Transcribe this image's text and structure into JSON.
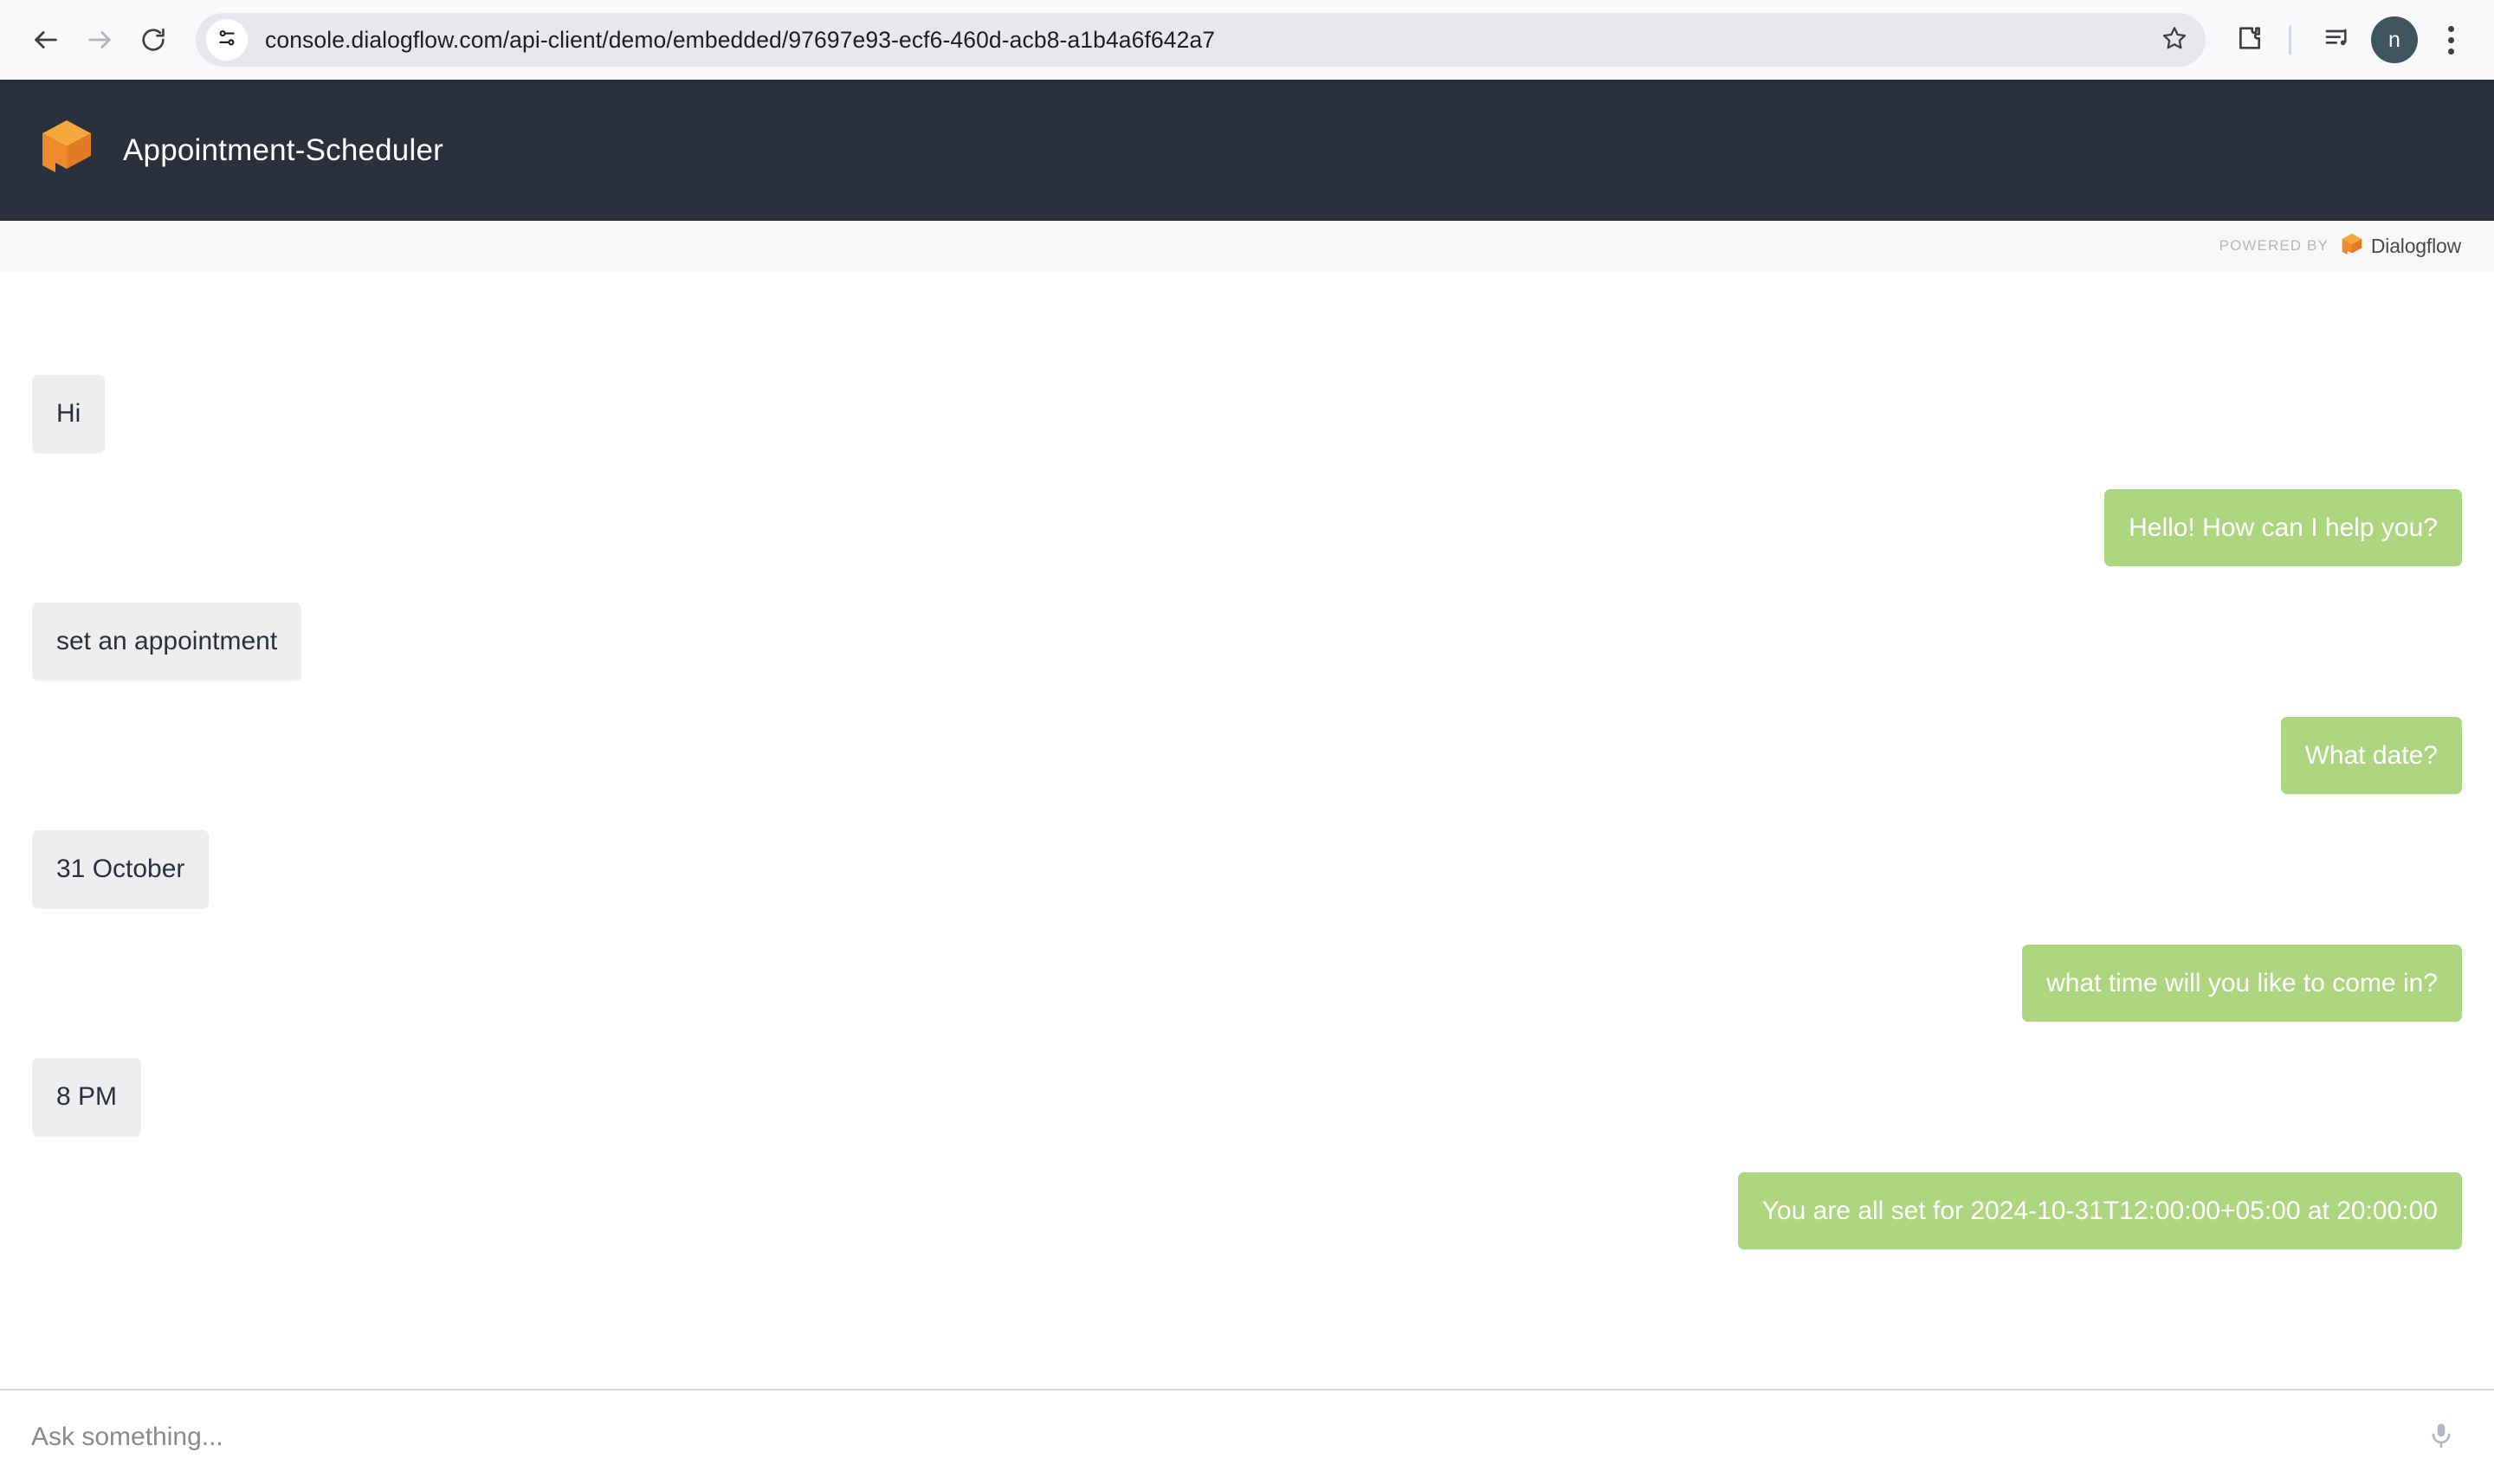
{
  "browser": {
    "url": "console.dialogflow.com/api-client/demo/embedded/97697e93-ecf6-460d-acb8-a1b4a6f642a7",
    "back_label": "back-arrow-icon",
    "forward_label": "forward-arrow-icon",
    "reload_label": "reload-icon",
    "site_info_label": "site-settings-icon",
    "bookmark_label": "star-icon",
    "extensions_label": "extensions-puzzle-icon",
    "media_label": "media-playlist-icon",
    "avatar_initial": "n",
    "menu_label": "three-dot-menu-icon"
  },
  "app": {
    "title": "Appointment-Scheduler",
    "logo_name": "dialogflow-cube-logo"
  },
  "powered_by": {
    "label": "POWERED BY",
    "brand": "Dialogflow",
    "logo_name": "dialogflow-cube-logo"
  },
  "chat": {
    "messages": [
      {
        "sender": "user",
        "text": "Hi"
      },
      {
        "sender": "bot",
        "text": "Hello! How can I help you?"
      },
      {
        "sender": "user",
        "text": "set an appointment"
      },
      {
        "sender": "bot",
        "text": "What date?"
      },
      {
        "sender": "user",
        "text": "31 October"
      },
      {
        "sender": "bot",
        "text": "what time will you like to come in?"
      },
      {
        "sender": "user",
        "text": "8 PM"
      },
      {
        "sender": "bot",
        "text": "You are all set for 2024-10-31T12:00:00+05:00 at 20:00:00"
      }
    ]
  },
  "composer": {
    "placeholder": "Ask something...",
    "value": "",
    "mic_label": "microphone-icon"
  },
  "colors": {
    "header_bg": "#2b303d",
    "bot_bubble": "#aed57f",
    "user_bubble": "#eeeeee",
    "brand_orange": "#ec8b2f",
    "brand_orange_light": "#f5a83c"
  }
}
